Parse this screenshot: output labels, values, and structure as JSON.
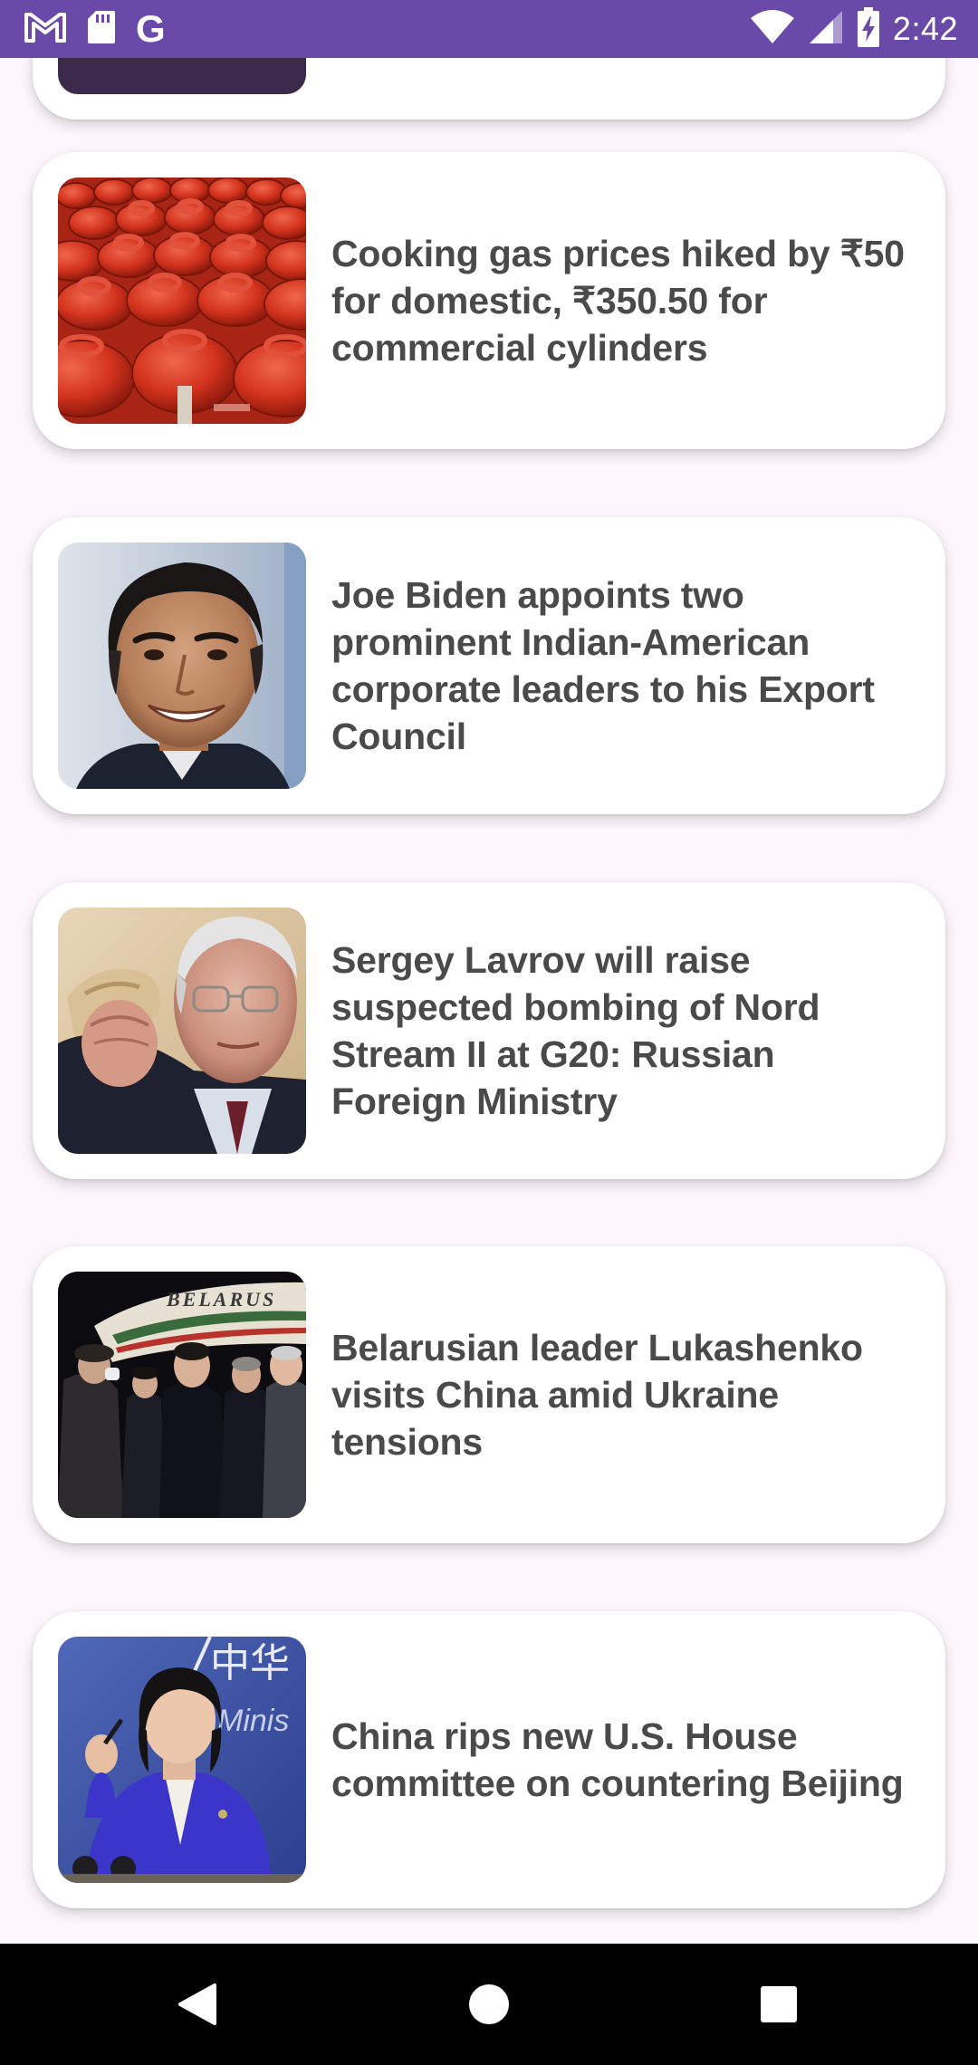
{
  "status_bar": {
    "time": "2:42",
    "left_icons": [
      "gmail-icon",
      "sd-card-icon",
      "google-icon"
    ],
    "google_letter": "G",
    "right_icons": [
      "wifi-icon",
      "cellular-signal-icon",
      "battery-charging-icon"
    ]
  },
  "feed": {
    "articles": [
      {
        "title": "Cooking gas prices hiked by ₹50 for domestic, ₹350.50 for commercial cylinders",
        "image": "gas-cylinders-photo"
      },
      {
        "title": "Joe Biden appoints two prominent Indian-American corporate leaders to his Export Council",
        "image": "smiling-man-portrait-photo"
      },
      {
        "title": "Sergey Lavrov will raise suspected bombing of Nord Stream II at G20: Russian Foreign Ministry",
        "image": "lavrov-photo"
      },
      {
        "title": "Belarusian leader Lukashenko visits China amid Ukraine tensions",
        "image": "airport-arrival-photo",
        "image_text": "BELARUS"
      },
      {
        "title": "China rips new U.S. House committee on countering Beijing",
        "image": "press-briefing-photo",
        "image_text": "中华",
        "image_text_2": "Minis"
      }
    ]
  },
  "nav_bar": {
    "buttons": [
      "back-button",
      "home-button",
      "recents-button"
    ]
  },
  "colors": {
    "status_bar": "#6a4aa8",
    "background": "#fdf7fd",
    "card": "#ffffff",
    "headline": "#4a4a4a",
    "nav_bar": "#000000"
  }
}
